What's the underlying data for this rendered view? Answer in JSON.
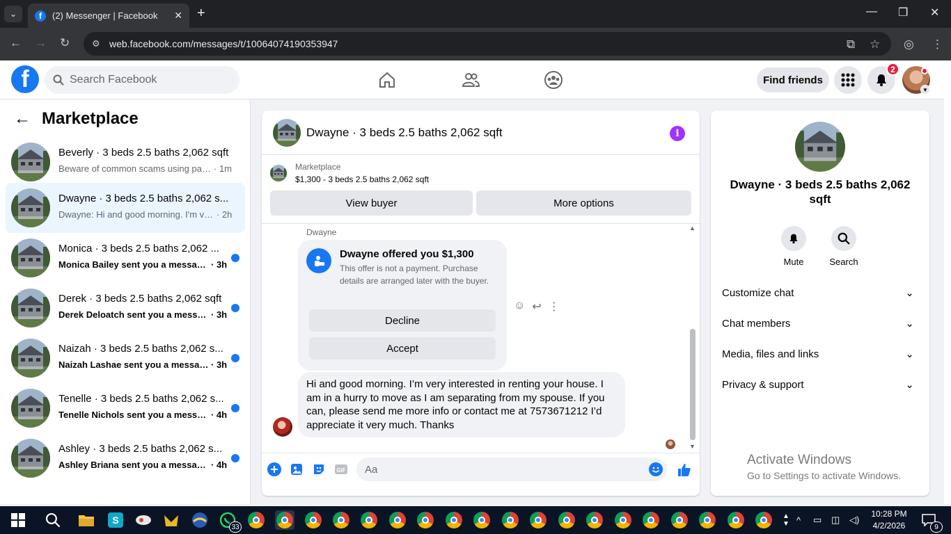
{
  "browser": {
    "tab_title": "(2) Messenger | Facebook",
    "url": "web.facebook.com/messages/t/10064074190353947"
  },
  "header": {
    "search_placeholder": "Search Facebook",
    "find_friends": "Find friends",
    "notification_count": "2"
  },
  "sidebar": {
    "title": "Marketplace",
    "conversations": [
      {
        "name": "Beverly · 3 beds 2.5 baths 2,062 sqft",
        "message": "Beware of common scams using pay...",
        "time": "· 1m",
        "unread": false,
        "active": false
      },
      {
        "name": "Dwayne · 3 beds 2.5 baths 2,062 s...",
        "message": "Dwayne: Hi and good morning. I'm ve...",
        "time": "· 2h",
        "unread": false,
        "active": true
      },
      {
        "name": "Monica · 3 beds 2.5 baths 2,062 ...",
        "message": "Monica Bailey sent you a message ...",
        "time": "· 3h",
        "unread": true,
        "active": false
      },
      {
        "name": "Derek · 3 beds 2.5 baths 2,062 sqft",
        "message": "Derek Deloatch sent you a messag...",
        "time": "· 3h",
        "unread": true,
        "active": false
      },
      {
        "name": "Naizah · 3 beds 2.5 baths 2,062 s...",
        "message": "Naizah Lashae sent you a message...",
        "time": "· 3h",
        "unread": true,
        "active": false
      },
      {
        "name": "Tenelle · 3 beds 2.5 baths 2,062 s...",
        "message": "Tenelle Nichols sent you a messag...",
        "time": "· 4h",
        "unread": true,
        "active": false
      },
      {
        "name": "Ashley · 3 beds 2.5 baths 2,062 s...",
        "message": "Ashley Briana sent you a message ...",
        "time": "· 4h",
        "unread": true,
        "active": false
      }
    ]
  },
  "chat": {
    "title": "Dwayne · 3 beds 2.5 baths 2,062 sqft",
    "marketplace_label": "Marketplace",
    "listing": "$1,300 - 3 beds 2.5 baths 2,062 sqft",
    "view_buyer": "View buyer",
    "more_options": "More options",
    "sender": "Dwayne",
    "offer_title": "Dwayne offered you $1,300",
    "offer_body": "This offer is not a payment. Purchase details are arranged later with the buyer.",
    "decline": "Decline",
    "accept": "Accept",
    "message": "Hi and good morning. I’m very interested in renting your house. I am in a hurry to move as I am separating from my spouse. If you can, please send me more info or contact me at 7573671212 I’d appreciate it very much. Thanks",
    "composer_placeholder": "Aa"
  },
  "info_panel": {
    "title": "Dwayne · 3 beds 2.5 baths 2,062 sqft",
    "mute": "Mute",
    "search": "Search",
    "sections": [
      "Customize chat",
      "Chat members",
      "Media, files and links",
      "Privacy & support"
    ]
  },
  "watermark": {
    "line1": "Activate Windows",
    "line2": "Go to Settings to activate Windows."
  },
  "taskbar": {
    "whatsapp_badge": "33",
    "time": "10:28 PM",
    "date": "4/2/2026",
    "notif_badge": "9"
  },
  "colors": {
    "brand": "#1877f2",
    "active_conv": "#ebf5ff",
    "info_icon": "#a033ff"
  }
}
